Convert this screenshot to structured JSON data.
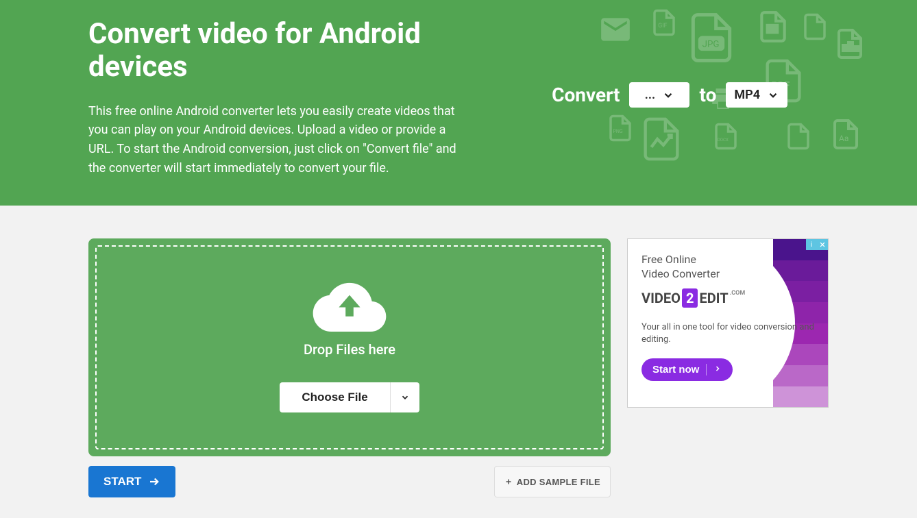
{
  "hero": {
    "title": "Convert video for Android devices",
    "description": "This free online Android converter lets you easily create videos that you can play on your Android devices. Upload a video or provide a URL. To start the Android conversion, just click on \"Convert file\" and the converter will start immediately to convert your file."
  },
  "convert_bar": {
    "label_convert": "Convert",
    "from_value": "...",
    "label_to": "to",
    "to_value": "MP4"
  },
  "dropzone": {
    "text": "Drop Files here",
    "choose_label": "Choose File"
  },
  "actions": {
    "start_label": "START",
    "sample_label": "ADD SAMPLE FILE"
  },
  "ad": {
    "title": "Free Online\nVideo Converter",
    "logo_pre": "VIDEO",
    "logo_mid": "2",
    "logo_post": "EDIT",
    "logo_com": ".COM",
    "subtitle": "Your all in one tool for video conversion and editing.",
    "cta": "Start now",
    "stripe_colors": [
      "#4a148c",
      "#6a1b9a",
      "#7b1fa2",
      "#8e24aa",
      "#9c27b0",
      "#ab47bc",
      "#ba68c8",
      "#ce93d8"
    ]
  }
}
